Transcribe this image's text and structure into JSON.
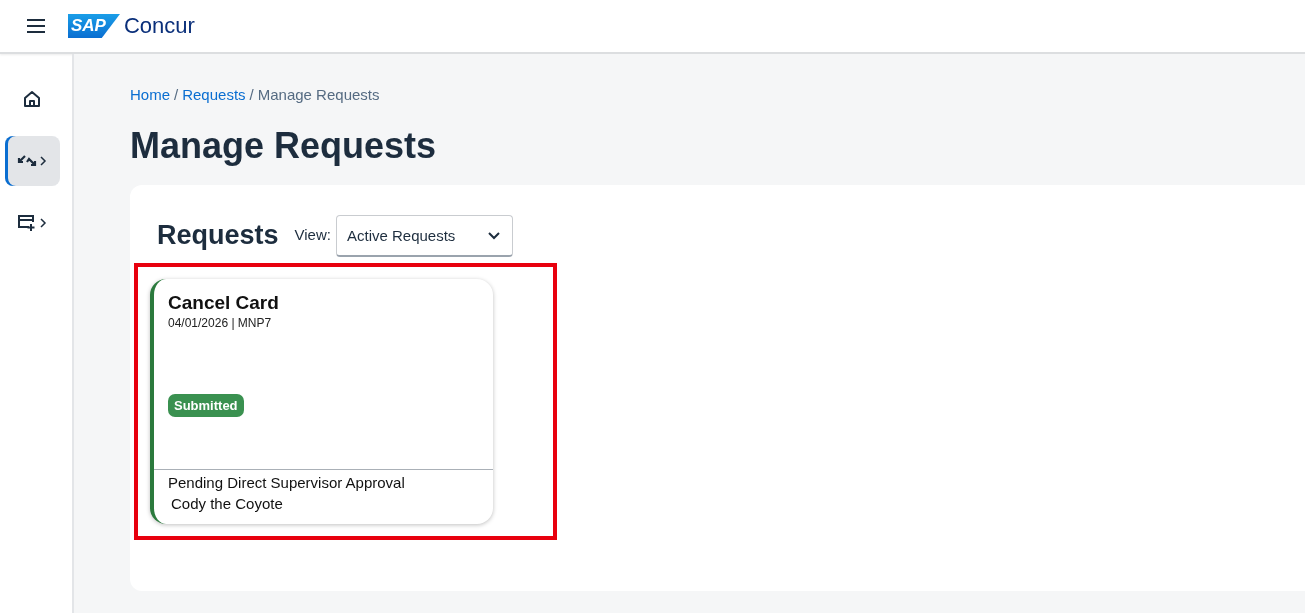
{
  "header": {
    "logo_badge": "SAP",
    "logo_text": "Concur"
  },
  "sidebar": {
    "items": [
      {
        "kind": "home",
        "selected": false,
        "has_submenu": false
      },
      {
        "kind": "requests",
        "selected": true,
        "has_submenu": true
      },
      {
        "kind": "card-add",
        "selected": false,
        "has_submenu": true
      }
    ]
  },
  "breadcrumb": [
    {
      "kind": "link",
      "label": "Home"
    },
    {
      "kind": "separator",
      "label": "/"
    },
    {
      "kind": "link",
      "label": "Requests"
    },
    {
      "kind": "separator",
      "label": "/"
    },
    {
      "kind": "current",
      "label": "Manage Requests"
    }
  ],
  "page_title": "Manage Requests",
  "panel": {
    "heading": "Requests",
    "view_label": "View:",
    "view_value": "Active Requests",
    "cards": [
      {
        "title": "Cancel Card",
        "meta": "04/01/2026 | MNP7",
        "status": "Submitted",
        "approval": "Pending Direct Supervisor Approval",
        "approver": "Cody the Coyote",
        "highlighted": true
      }
    ]
  }
}
